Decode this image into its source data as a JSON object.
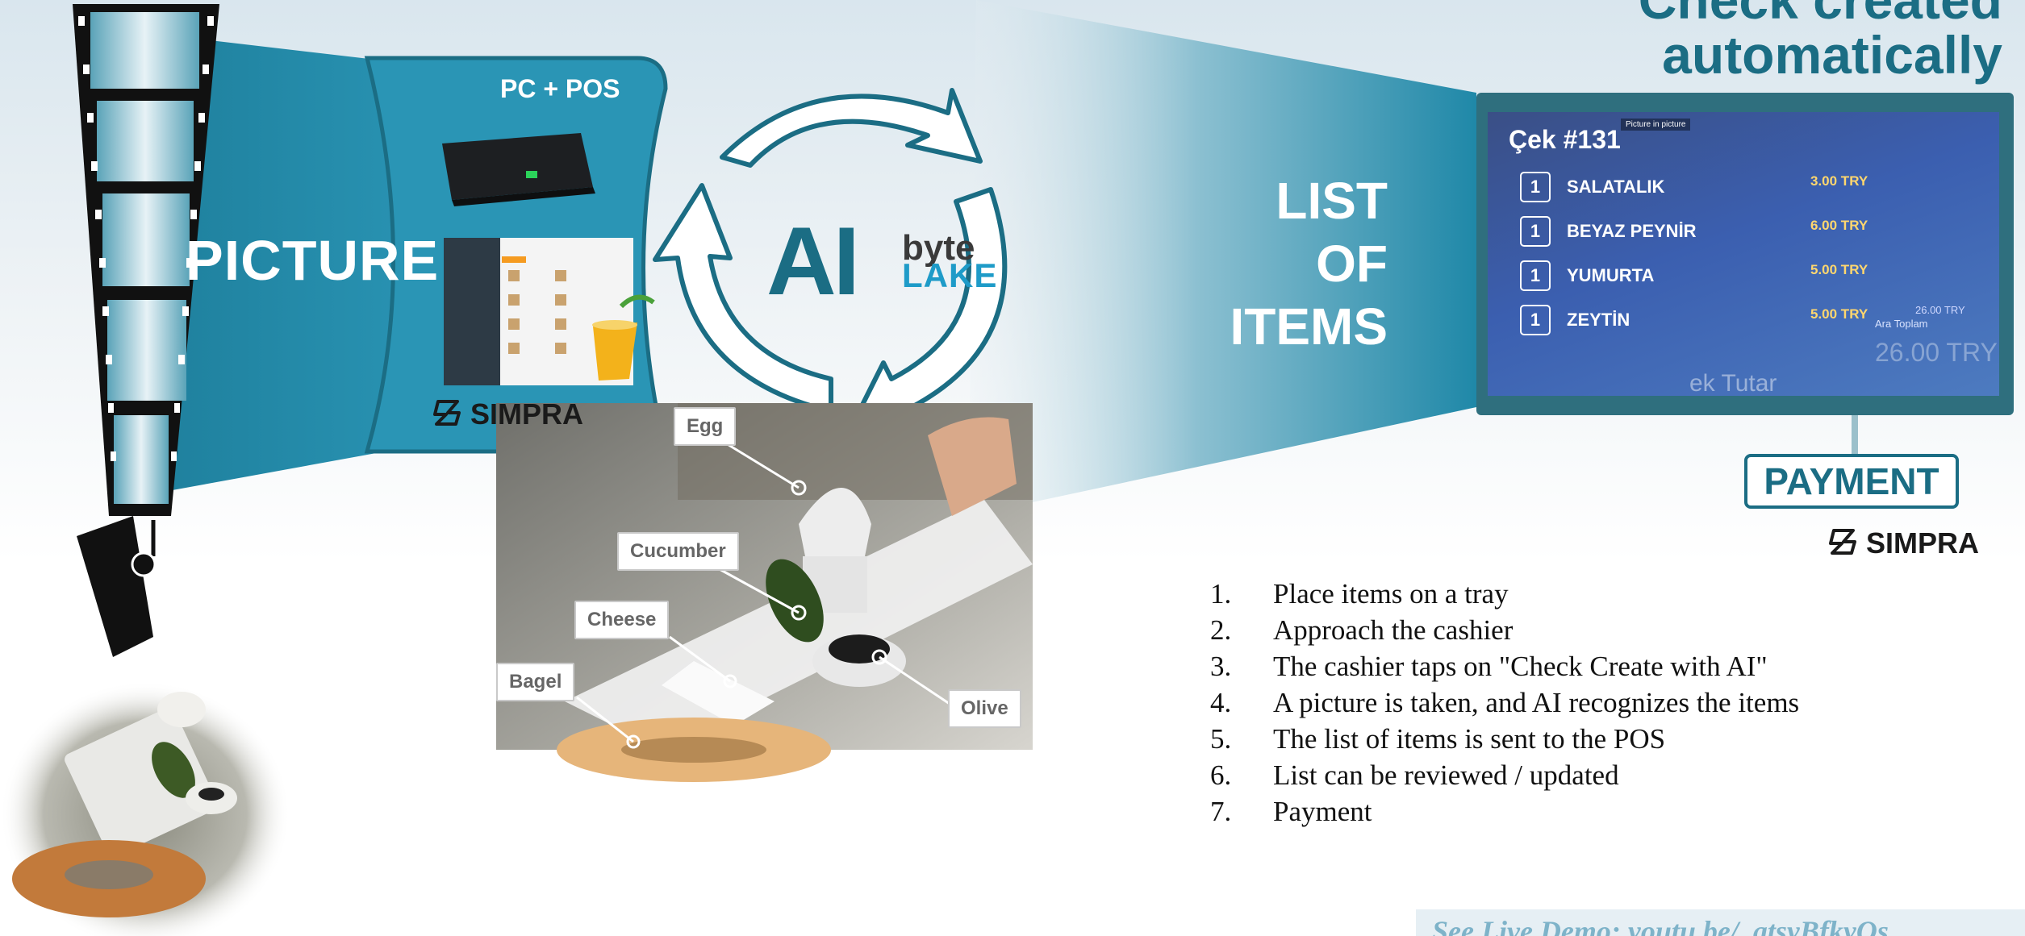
{
  "headline": {
    "line1": "Check created",
    "line2": "automatically"
  },
  "labels": {
    "picture": "PICTURE",
    "pc_pos": "PC + POS",
    "list_line1": "LIST",
    "list_line2": "OF",
    "list_line3": "ITEMS",
    "payment": "PAYMENT"
  },
  "brands": {
    "simpra": "SIMPRA",
    "ai": "AI",
    "byte": "byte",
    "lake": "LAKE"
  },
  "tray_tags": [
    "Egg",
    "Cucumber",
    "Cheese",
    "Bagel",
    "Olive"
  ],
  "check": {
    "title": "Çek #131",
    "pip_label": "Picture in picture",
    "items": [
      {
        "qty": "1",
        "name": "SALATALIK",
        "price": "3.00 TRY"
      },
      {
        "qty": "1",
        "name": "BEYAZ PEYNİR",
        "price": "6.00 TRY"
      },
      {
        "qty": "1",
        "name": "YUMURTA",
        "price": "5.00 TRY"
      },
      {
        "qty": "1",
        "name": "ZEYTİN",
        "price": "5.00 TRY"
      }
    ],
    "subtotal_label": "Ara Toplam",
    "subtotal_value": "26.00 TRY",
    "total_value": "26.00 TRY",
    "total_label": "ek Tutar"
  },
  "steps": [
    {
      "num": "1.",
      "text": "Place items on a tray"
    },
    {
      "num": "2.",
      "text": "Approach the cashier"
    },
    {
      "num": "3.",
      "text": "The cashier taps on \"Check Create with AI\""
    },
    {
      "num": "4.",
      "text": "A picture is taken, and AI recognizes the items"
    },
    {
      "num": "5.",
      "text": "The list of items is sent to the POS"
    },
    {
      "num": "6.",
      "text": "List can be reviewed / updated"
    },
    {
      "num": "7.",
      "text": "Payment"
    }
  ],
  "footer": {
    "text": "See Live Demo: youtu.be/_atsyBfkyOs"
  },
  "colors": {
    "teal": "#1b6d84",
    "teal_mid": "#2a8fad",
    "accent_blue": "#1e9bc8",
    "screen_blue": "#3b5fb0"
  }
}
